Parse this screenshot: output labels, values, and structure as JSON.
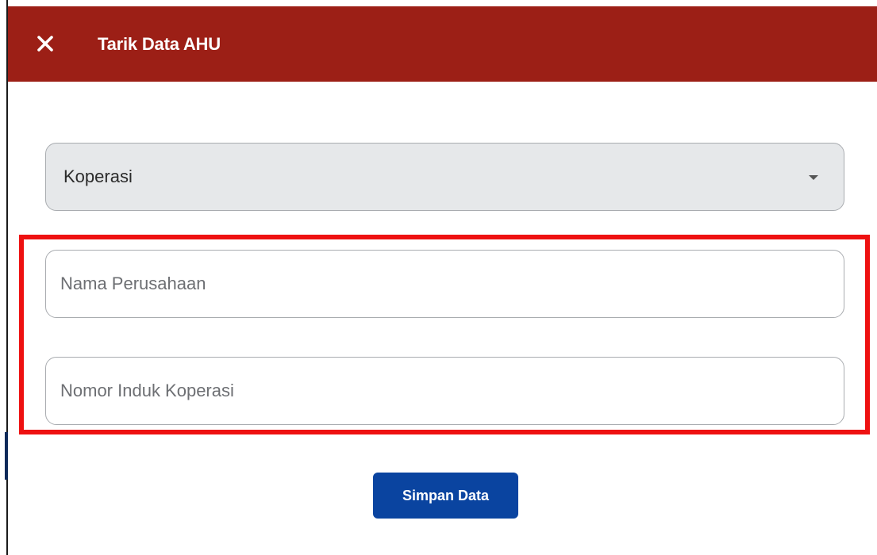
{
  "dialog": {
    "title": "Tarik Data AHU",
    "close_icon": "close-icon"
  },
  "form": {
    "entity_type": {
      "selected": "Koperasi",
      "icon": "chevron-down-icon"
    },
    "company_name": {
      "value": "",
      "placeholder": "Nama Perusahaan"
    },
    "cooperative_number": {
      "value": "",
      "placeholder": "Nomor Induk Koperasi"
    },
    "save_label": "Simpan Data"
  },
  "colors": {
    "header": "#9c1f16",
    "primary_button": "#0a44a0",
    "highlight": "#ee1111",
    "select_bg": "#e6e8ea"
  }
}
